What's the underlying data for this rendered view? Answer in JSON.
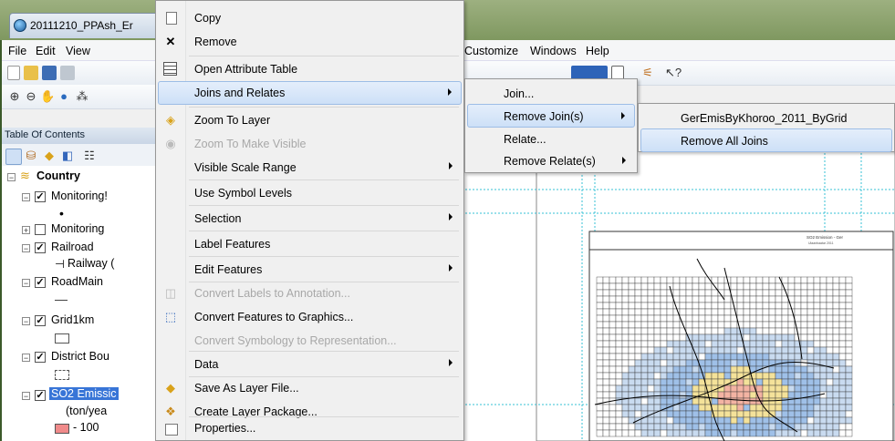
{
  "window": {
    "title": "20111210_PPAsh_Er"
  },
  "menubar": {
    "items": [
      "File",
      "Edit",
      "View",
      "Customize",
      "Windows",
      "Help"
    ]
  },
  "toc": {
    "title": "Table Of Contents",
    "rows": [
      {
        "label": "Country",
        "bold": true
      },
      {
        "label": "Monitoring!"
      },
      {
        "label": "Monitoring"
      },
      {
        "label": "Railroad"
      },
      {
        "label": "Railway ("
      },
      {
        "label": "RoadMain"
      },
      {
        "label": "Grid1km"
      },
      {
        "label": "District Bou"
      },
      {
        "label": "SO2 Emissic"
      },
      {
        "label": "(ton/yea"
      },
      {
        "label": "- 100"
      }
    ]
  },
  "context_menu": {
    "items": [
      {
        "label": "Copy",
        "icon": "copy-icon"
      },
      {
        "label": "Remove",
        "icon": "close-icon"
      },
      {
        "label": "Open Attribute Table",
        "icon": "table-icon"
      },
      {
        "label": "Joins and Relates",
        "has_submenu": true,
        "highlighted": true
      },
      {
        "label": "Zoom To Layer",
        "icon": "zoom-layer-icon"
      },
      {
        "label": "Zoom To Make Visible",
        "disabled": true
      },
      {
        "label": "Visible Scale Range",
        "has_submenu": true
      },
      {
        "label": "Use Symbol Levels"
      },
      {
        "label": "Selection",
        "has_submenu": true
      },
      {
        "label": "Label Features"
      },
      {
        "label": "Edit Features",
        "has_submenu": true
      },
      {
        "label": "Convert Labels to Annotation...",
        "disabled": true
      },
      {
        "label": "Convert Features to Graphics...",
        "icon": "convert-graphics-icon"
      },
      {
        "label": "Convert Symbology to Representation...",
        "disabled": true
      },
      {
        "label": "Data",
        "has_submenu": true
      },
      {
        "label": "Save As Layer File...",
        "icon": "save-layer-icon"
      },
      {
        "label": "Create Layer Package...",
        "icon": "layer-package-icon"
      },
      {
        "label": "Properties...",
        "icon": "properties-icon"
      }
    ]
  },
  "joins_submenu": {
    "items": [
      {
        "label": "Join..."
      },
      {
        "label": "Remove Join(s)",
        "has_submenu": true,
        "highlighted": true
      },
      {
        "label": "Relate..."
      },
      {
        "label": "Remove Relate(s)",
        "has_submenu": true
      }
    ]
  },
  "remove_join_submenu": {
    "items": [
      {
        "label": "GerEmisByKhoroo_2011_ByGrid"
      },
      {
        "label": "Remove All Joins",
        "highlighted": true
      }
    ]
  },
  "map": {
    "layout_title": "SO2 Emission - Ger",
    "layout_subtitle": "Ulaanbaatar 2011"
  }
}
